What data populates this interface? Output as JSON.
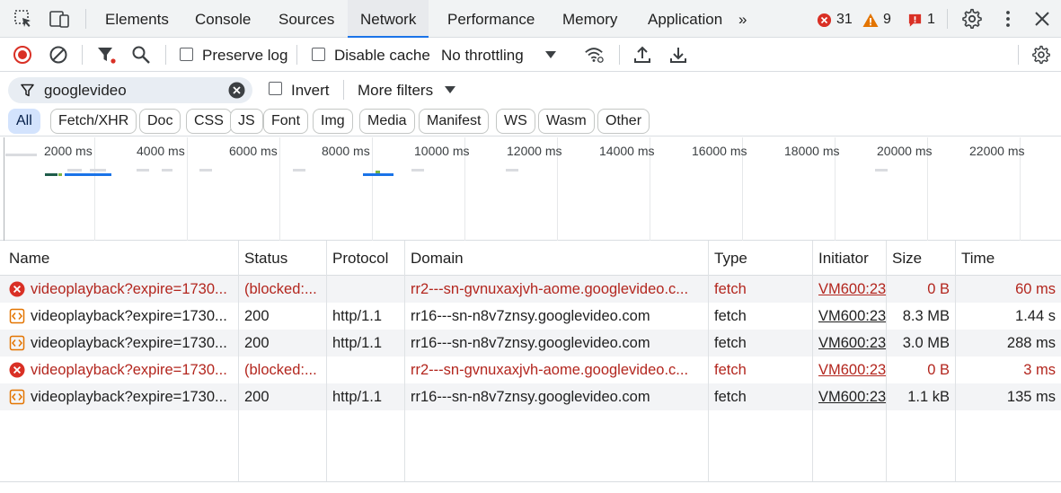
{
  "tabs": [
    {
      "label": "Elements",
      "active": false
    },
    {
      "label": "Console",
      "active": false
    },
    {
      "label": "Sources",
      "active": false
    },
    {
      "label": "Network",
      "active": true
    },
    {
      "label": "Performance",
      "active": false
    },
    {
      "label": "Memory",
      "active": false
    },
    {
      "label": "Application",
      "active": false
    }
  ],
  "more_tabs_glyph": "»",
  "badges": {
    "errors": "31",
    "warnings": "9",
    "issues": "1"
  },
  "toolbar": {
    "preserve_log": "Preserve log",
    "disable_cache": "Disable cache",
    "throttling": "No throttling"
  },
  "filter": {
    "query": "googlevideo",
    "invert": "Invert",
    "more_filters": "More filters"
  },
  "chips": [
    {
      "label": "All",
      "active": true
    },
    {
      "label": "Fetch/XHR",
      "active": false
    },
    {
      "label": "Doc",
      "active": false
    },
    {
      "label": "CSS",
      "active": false
    },
    {
      "label": "JS",
      "active": false
    },
    {
      "label": "Font",
      "active": false
    },
    {
      "label": "Img",
      "active": false
    },
    {
      "label": "Media",
      "active": false
    },
    {
      "label": "Manifest",
      "active": false
    },
    {
      "label": "WS",
      "active": false
    },
    {
      "label": "Wasm",
      "active": false
    },
    {
      "label": "Other",
      "active": false
    }
  ],
  "overview_ticks": [
    "2000 ms",
    "4000 ms",
    "6000 ms",
    "8000 ms",
    "10000 ms",
    "12000 ms",
    "14000 ms",
    "16000 ms",
    "18000 ms",
    "20000 ms",
    "22000 ms"
  ],
  "columns": [
    "Name",
    "Status",
    "Protocol",
    "Domain",
    "Type",
    "Initiator",
    "Size",
    "Time"
  ],
  "rows": [
    {
      "failed": true,
      "name": "videoplayback?expire=1730...",
      "status": "(blocked:...",
      "protocol": "",
      "domain": "rr2---sn-gvnuxaxjvh-aome.googlevideo.c...",
      "type": "fetch",
      "initiator": "VM600:23",
      "size": "0 B",
      "time": "60 ms"
    },
    {
      "failed": false,
      "name": "videoplayback?expire=1730...",
      "status": "200",
      "protocol": "http/1.1",
      "domain": "rr16---sn-n8v7znsy.googlevideo.com",
      "type": "fetch",
      "initiator": "VM600:23",
      "size": "8.3 MB",
      "time": "1.44 s"
    },
    {
      "failed": false,
      "name": "videoplayback?expire=1730...",
      "status": "200",
      "protocol": "http/1.1",
      "domain": "rr16---sn-n8v7znsy.googlevideo.com",
      "type": "fetch",
      "initiator": "VM600:23",
      "size": "3.0 MB",
      "time": "288 ms"
    },
    {
      "failed": true,
      "name": "videoplayback?expire=1730...",
      "status": "(blocked:...",
      "protocol": "",
      "domain": "rr2---sn-gvnuxaxjvh-aome.googlevideo.c...",
      "type": "fetch",
      "initiator": "VM600:23",
      "size": "0 B",
      "time": "3 ms"
    },
    {
      "failed": false,
      "name": "videoplayback?expire=1730...",
      "status": "200",
      "protocol": "http/1.1",
      "domain": "rr16---sn-n8v7znsy.googlevideo.com",
      "type": "fetch",
      "initiator": "VM600:23",
      "size": "1.1 kB",
      "time": "135 ms"
    }
  ],
  "colors": {
    "accent": "#1a73e8",
    "error": "#b3261e",
    "error_icon": "#d93025",
    "warning": "#e37400",
    "record": "#d93025"
  }
}
